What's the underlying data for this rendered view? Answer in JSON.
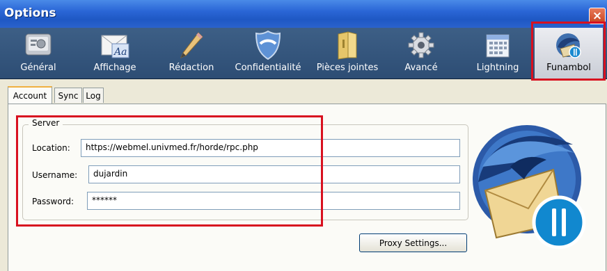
{
  "window": {
    "title": "Options",
    "close_glyph": "×"
  },
  "toolbar": {
    "items": [
      {
        "label": "Général",
        "icon": "general-icon"
      },
      {
        "label": "Affichage",
        "icon": "display-icon"
      },
      {
        "label": "Rédaction",
        "icon": "pencil-icon"
      },
      {
        "label": "Confidentialité",
        "icon": "shield-icon"
      },
      {
        "label": "Pièces jointes",
        "icon": "folder-icon"
      },
      {
        "label": "Avancé",
        "icon": "gear-icon"
      },
      {
        "label": "Lightning",
        "icon": "calendar-icon"
      },
      {
        "label": "Funambol",
        "icon": "funambol-icon"
      }
    ],
    "selected": "Funambol",
    "affichage_glyph": "Aa"
  },
  "tabs": [
    {
      "label": "Account"
    },
    {
      "label": "Sync"
    },
    {
      "label": "Log"
    }
  ],
  "active_tab": "Account",
  "server": {
    "legend": "Server",
    "location_label": "Location:",
    "location_value": "https://webmel.univmed.fr/horde/rpc.php",
    "username_label": "Username:",
    "username_value": "dujardin",
    "password_label": "Password:",
    "password_value": "******"
  },
  "proxy_button": "Proxy Settings...",
  "colors": {
    "highlight": "#d8101f",
    "titlebar": "#2a66d6",
    "toolbar": "#35577e",
    "panel": "#fbfbf7"
  }
}
